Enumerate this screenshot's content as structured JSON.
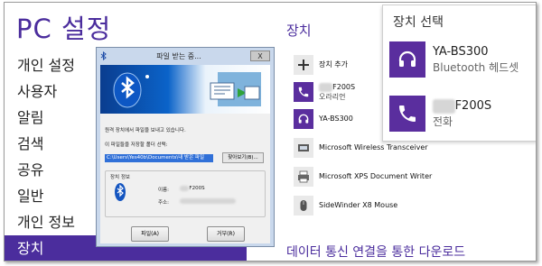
{
  "nav": {
    "title": "PC 설정",
    "items": [
      {
        "label": "개인 설정",
        "active": false
      },
      {
        "label": "사용자",
        "active": false
      },
      {
        "label": "알림",
        "active": false
      },
      {
        "label": "검색",
        "active": false
      },
      {
        "label": "공유",
        "active": false
      },
      {
        "label": "일반",
        "active": false
      },
      {
        "label": "개인 정보",
        "active": false
      },
      {
        "label": "장치",
        "active": true
      }
    ]
  },
  "devices": {
    "title": "장치",
    "add_label": "장치 추가",
    "list": [
      {
        "name": "F200S",
        "sub": "오라리언",
        "icon": "phone-icon"
      },
      {
        "name": "YA-BS300",
        "sub": "",
        "icon": "headset-icon"
      },
      {
        "name": "Microsoft Wireless Transceiver",
        "sub": "",
        "icon": "device-icon"
      },
      {
        "name": "Microsoft XPS Document Writer",
        "sub": "",
        "icon": "printer-icon"
      },
      {
        "name": "SideWinder X8 Mouse",
        "sub": "",
        "icon": "mouse-icon"
      }
    ],
    "bottom_link": "데이터 통신 연결을 통한 다운로드"
  },
  "flyout": {
    "title": "장치 선택",
    "items": [
      {
        "name": "YA-BS300",
        "sub": "Bluetooth 헤드셋",
        "icon": "headset-icon"
      },
      {
        "name": "F200S",
        "sub": "전화",
        "icon": "phone-icon"
      }
    ]
  },
  "dialog": {
    "title": "파일 받는 중...",
    "close_label": "X",
    "message": "원격 장치에서 파일을 보내고 있습니다.",
    "save_prompt": "이 파일들을 저장할 폴더 선택:",
    "path": "C:\\Users\\Yes40b\\Documents\\내 받은 파일",
    "browse_label": "찾아보기(B)...",
    "info_title": "장치 정보",
    "name_label": "이름:",
    "name_value": "F200S",
    "address_label": "주소:",
    "receive_label": "파일(A)",
    "reject_label": "거부(R)"
  },
  "colors": {
    "accent": "#4b2d9d",
    "tile": "#5a2e9e",
    "dialog_frame": "#c9d8ec"
  }
}
